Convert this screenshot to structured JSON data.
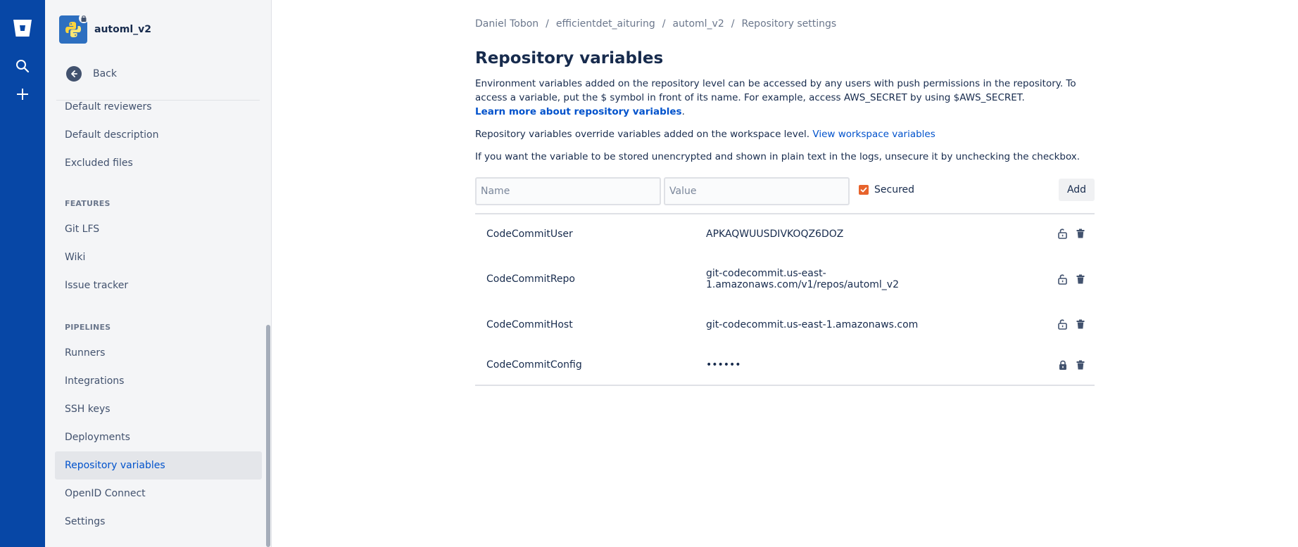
{
  "repo": {
    "name": "automl_v2"
  },
  "sidebar": {
    "back_label": "Back",
    "items_top": [
      "Default reviewers",
      "Default description",
      "Excluded files"
    ],
    "features_header": "FEATURES",
    "features": [
      "Git LFS",
      "Wiki",
      "Issue tracker"
    ],
    "pipelines_header": "PIPELINES",
    "pipelines": [
      "Runners",
      "Integrations",
      "SSH keys",
      "Deployments",
      "Repository variables",
      "OpenID Connect",
      "Settings"
    ],
    "active": "Repository variables"
  },
  "breadcrumb": [
    "Daniel Tobon",
    "efficientdet_aituring",
    "automl_v2",
    "Repository settings"
  ],
  "page": {
    "title": "Repository variables",
    "desc1": "Environment variables added on the repository level can be accessed by any users with push permissions in the repository. To access a variable, put the $ symbol in front of its name. For example, access AWS_SECRET by using $AWS_SECRET.",
    "learn_more": "Learn more about repository variables",
    "desc2": "Repository variables override variables added on the workspace level.",
    "workspace_link": "View workspace variables",
    "desc3": "If you want the variable to be stored unencrypted and shown in plain text in the logs, unsecure it by unchecking the checkbox."
  },
  "form": {
    "name_placeholder": "Name",
    "value_placeholder": "Value",
    "secured_label": "Secured",
    "secured_checked": true,
    "add_label": "Add"
  },
  "variables": [
    {
      "name": "CodeCommitUser",
      "value": "APKAQWUUSDIVKOQZ6DOZ",
      "secured": false
    },
    {
      "name": "CodeCommitRepo",
      "value": "git-codecommit.us-east-1.amazonaws.com/v1/repos/automl_v2",
      "secured": false
    },
    {
      "name": "CodeCommitHost",
      "value": "git-codecommit.us-east-1.amazonaws.com",
      "secured": false
    },
    {
      "name": "CodeCommitConfig",
      "value": "••••••",
      "secured": true
    }
  ],
  "colors": {
    "rail": "#0747a6",
    "link": "#0052cc",
    "checkbox": "#e7632c"
  }
}
